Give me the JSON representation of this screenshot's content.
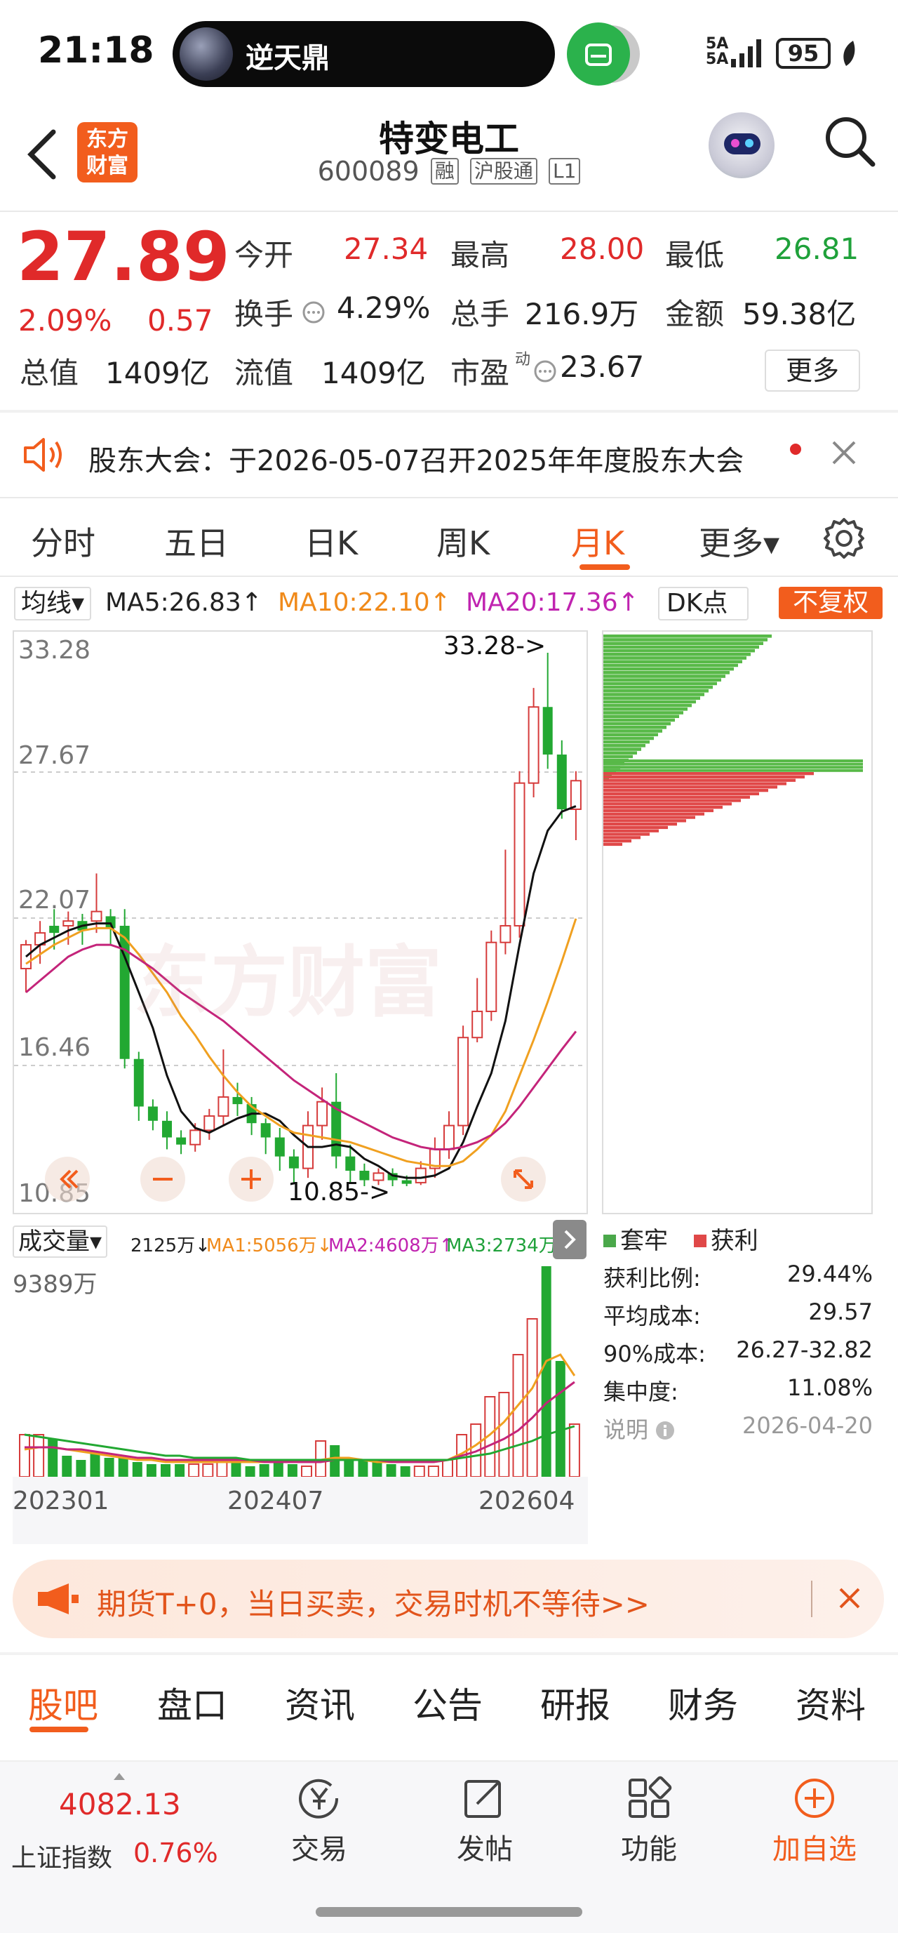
{
  "status_bar": {
    "time": "21:18",
    "live_name": "逆天鼎",
    "signal": "5A\n5A",
    "battery": "95"
  },
  "header": {
    "logo_line1": "东方",
    "logo_line2": "财富",
    "stock_name": "特变电工",
    "stock_code": "600089",
    "tags": [
      "融",
      "沪股通",
      "L1"
    ]
  },
  "quote": {
    "price": "27.89",
    "pct": "2.09%",
    "change": "0.57",
    "open_label": "今开",
    "open": "27.34",
    "high_label": "最高",
    "high": "28.00",
    "low_label": "最低",
    "low": "26.81",
    "turnover_label": "换手",
    "turnover": "4.29%",
    "volume_label": "总手",
    "volume": "216.9万",
    "amount_label": "金额",
    "amount": "59.38亿",
    "mktcap_label": "总值",
    "mktcap": "1409亿",
    "float_label": "流值",
    "float": "1409亿",
    "pe_label": "市盈",
    "pe_sup": "动",
    "pe": "23.67",
    "more": "更多"
  },
  "notice": {
    "text": "股东大会：于2026-05-07召开2025年年度股东大会"
  },
  "period_tabs": [
    "分时",
    "五日",
    "日K",
    "周K",
    "月K",
    "更多▾"
  ],
  "active_period": "月K",
  "ma": {
    "selector": "均线▾",
    "ma5": "MA5:26.83↑",
    "ma10": "MA10:22.10↑",
    "ma20": "MA20:17.36↑",
    "dk": "DK点",
    "fq": "不复权"
  },
  "kline": {
    "y_ticks": [
      "33.28",
      "27.67",
      "22.07",
      "16.46",
      "10.85"
    ],
    "high_marker": "33.28->",
    "low_marker": "10.85->",
    "watermark": "东方财富"
  },
  "volume": {
    "selector": "成交量▾",
    "v": "2125万↓",
    "ma1": "MA1:5056万↓",
    "ma2": "MA2:4608万↑",
    "ma3": "MA3:2734万↑",
    "max": "9389万",
    "x_labels": [
      "202301",
      "202407",
      "202604"
    ]
  },
  "chip": {
    "legend_trapped": "套牢",
    "legend_profit": "获利",
    "stats": [
      {
        "label": "获利比例:",
        "value": "29.44%"
      },
      {
        "label": "平均成本:",
        "value": "29.57"
      },
      {
        "label": "90%成本:",
        "value": "26.27-32.82"
      },
      {
        "label": "集中度:",
        "value": "11.08%"
      },
      {
        "label": "说明",
        "value": "2026-04-20"
      }
    ]
  },
  "promo": {
    "text": "期货T+0，当日买卖，交易时机不等待>>"
  },
  "content_tabs": [
    "股吧",
    "盘口",
    "资讯",
    "公告",
    "研报",
    "财务",
    "资料"
  ],
  "bottom_nav": {
    "index_value": "4082.13",
    "index_name": "上证指数",
    "index_pct": "0.76%",
    "items": [
      "交易",
      "发帖",
      "功能",
      "加自选"
    ]
  },
  "colors": {
    "accent": "#f25d1d",
    "up": "#e02a2a",
    "down": "#1fa13a",
    "ma5": "#111111",
    "ma10": "#f0a020",
    "ma20": "#c4247a"
  }
}
